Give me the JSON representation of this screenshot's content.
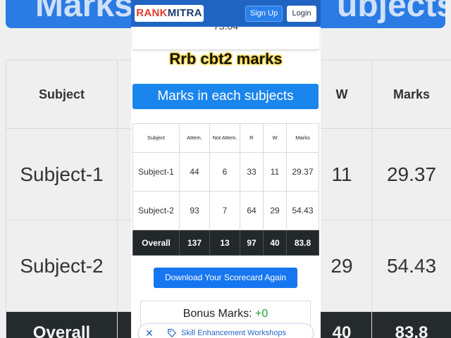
{
  "background": {
    "banner_left": "Marks",
    "banner_right": "ubjects",
    "headers": [
      "Subject",
      "",
      "W",
      "Marks"
    ],
    "rows": [
      {
        "subject": "Subject-1",
        "w": "11",
        "marks": "29.37"
      },
      {
        "subject": "Subject-2",
        "w": "29",
        "marks": "54.43"
      }
    ],
    "total": {
      "label": "Overall",
      "w": "40",
      "marks": "83.8"
    }
  },
  "header": {
    "logo_rank": "RANK",
    "logo_mitra": "MITRA",
    "signup_label": "Sign Up",
    "login_label": "Login"
  },
  "previous_card": {
    "value": "73.04"
  },
  "title": "Rrb cbt2 marks",
  "section_title": "Marks in each subjects",
  "table": {
    "headers": [
      "Subject",
      "Attem.",
      "Not Attem.",
      "R",
      "W",
      "Marks"
    ],
    "rows": [
      [
        "Subject-1",
        "44",
        "6",
        "33",
        "11",
        "29.37"
      ],
      [
        "Subject-2",
        "93",
        "7",
        "64",
        "29",
        "54.43"
      ]
    ],
    "total": [
      "Overall",
      "137",
      "13",
      "97",
      "40",
      "83.8"
    ]
  },
  "download_button": "Download Your Scorecard Again",
  "bonus": {
    "label": "Bonus Marks:",
    "value": "+0"
  },
  "bottom_banner": {
    "close_icon": "close-icon",
    "tag_icon": "tag-icon",
    "text": "Skill Enhancement Workshops"
  },
  "colors": {
    "primary": "#1a85ec",
    "nav": "#1f64c1",
    "total_row": "#23282a",
    "bonus_green": "#1f9d3a",
    "title_glow": "#f2c500",
    "logo_red": "#e23b2c"
  }
}
